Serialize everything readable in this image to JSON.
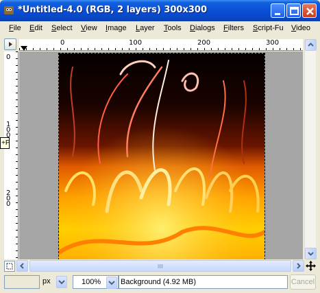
{
  "window": {
    "title": "*Untitled-4.0 (RGB, 2 layers) 300x300",
    "app_icon": "gimp-icon",
    "controls": [
      "minimize-icon",
      "maximize-icon",
      "close-icon"
    ]
  },
  "menubar": {
    "items": [
      {
        "u": "F",
        "rest": "ile"
      },
      {
        "u": "E",
        "rest": "dit"
      },
      {
        "u": "S",
        "rest": "elect"
      },
      {
        "u": "V",
        "rest": "iew"
      },
      {
        "u": "I",
        "rest": "mage"
      },
      {
        "u": "L",
        "rest": "ayer"
      },
      {
        "u": "T",
        "rest": "ools"
      },
      {
        "u": "D",
        "rest": "ialogs"
      },
      {
        "u": "F",
        "rest": "ilters",
        "pre": ""
      },
      {
        "u": "S",
        "rest": "cript-Fu"
      },
      {
        "u": "V",
        "rest": "ideo"
      }
    ]
  },
  "rulers": {
    "horizontal_labels": [
      "0",
      "100",
      "200",
      "300"
    ],
    "vertical_labels": [
      [
        "0"
      ],
      [
        "1",
        "0",
        "0"
      ],
      [
        "2",
        "0",
        "0"
      ]
    ]
  },
  "canvas": {
    "image_description_colors": [
      "#000000",
      "#ff4000",
      "#ffd000"
    ],
    "tooltip": "+P"
  },
  "statusbar": {
    "coords": "",
    "unit": "px",
    "zoom": "100%",
    "layer_info": "Background (4.92 MB)",
    "cancel_label": "Cancel"
  }
}
